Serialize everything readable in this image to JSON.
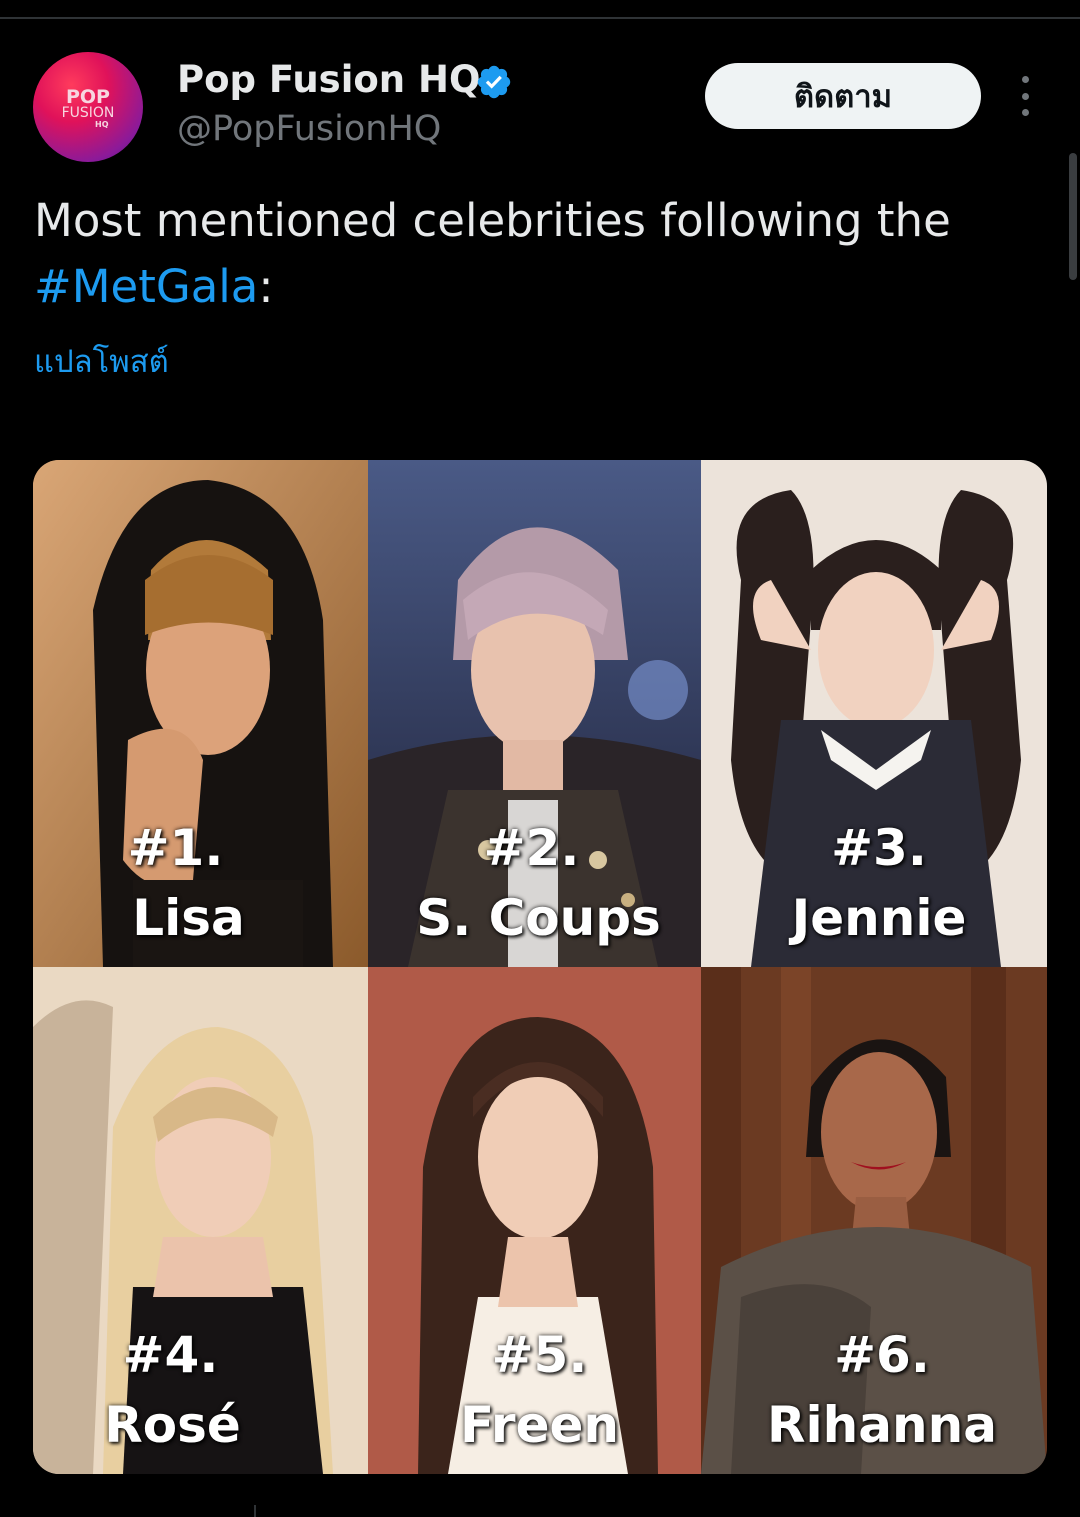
{
  "account": {
    "display_name": "Pop Fusion HQ",
    "handle": "@PopFusionHQ",
    "verified": true,
    "avatar_logo": {
      "line1": "POP",
      "line2": "FUSION",
      "line3": "HQ"
    }
  },
  "actions": {
    "follow_label": "ติดตาม",
    "more_icon": "more-vertical-icon"
  },
  "tweet": {
    "text_before": "Most mentioned celebrities following the ",
    "hashtag": "#MetGala",
    "text_after": ":",
    "translate_label": "แปลโพสต์"
  },
  "media": {
    "cells": [
      {
        "rank": "#1.",
        "name": "Lisa"
      },
      {
        "rank": "#2.",
        "name": "S. Coups"
      },
      {
        "rank": "#3.",
        "name": "Jennie"
      },
      {
        "rank": "#4.",
        "name": "Rosé"
      },
      {
        "rank": "#5.",
        "name": "Freen"
      },
      {
        "rank": "#6.",
        "name": "Rihanna"
      }
    ]
  },
  "colors": {
    "background": "#000000",
    "link": "#1d9bf0",
    "primary_text": "#e7e9ea",
    "secondary_text": "#71767b",
    "follow_button_bg": "#eff3f4"
  }
}
